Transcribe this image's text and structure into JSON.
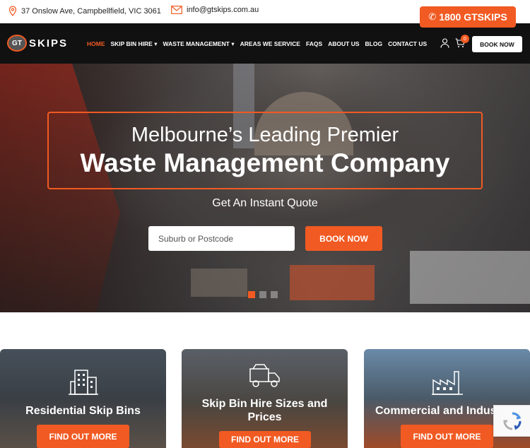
{
  "topbar": {
    "address": "37 Onslow Ave, Campbellfield, VIC 3061",
    "email": "info@gtskips.com.au",
    "phone": "1800 GTSKIPS"
  },
  "brand": {
    "logo_badge": "GT",
    "logo_word": "SKIPS"
  },
  "nav": {
    "items": [
      "HOME",
      "SKIP BIN HIRE",
      "WASTE MANAGEMENT",
      "AREAS WE SERVICE",
      "FAQS",
      "ABOUT US",
      "BLOG",
      "CONTACT US"
    ],
    "cart_count": "0",
    "book_label": "BOOK NOW"
  },
  "hero": {
    "line1": "Melbourne’s Leading Premier",
    "line2": "Waste Management Company",
    "quote_label": "Get An Instant Quote",
    "search_placeholder": "Suburb or Postcode",
    "book_label": "BOOK NOW",
    "active_slide": 1,
    "slide_count": 3
  },
  "cards": [
    {
      "title": "Residential Skip Bins",
      "button": "FIND OUT MORE",
      "icon": "building-icon"
    },
    {
      "title": "Skip Bin Hire Sizes and Prices",
      "button": "FIND OUT MORE",
      "icon": "truck-icon"
    },
    {
      "title": "Commercial and Indus",
      "button": "FIND OUT MORE",
      "icon": "factory-icon"
    }
  ],
  "colors": {
    "accent": "#f15a22",
    "nav_bg": "#111111"
  }
}
